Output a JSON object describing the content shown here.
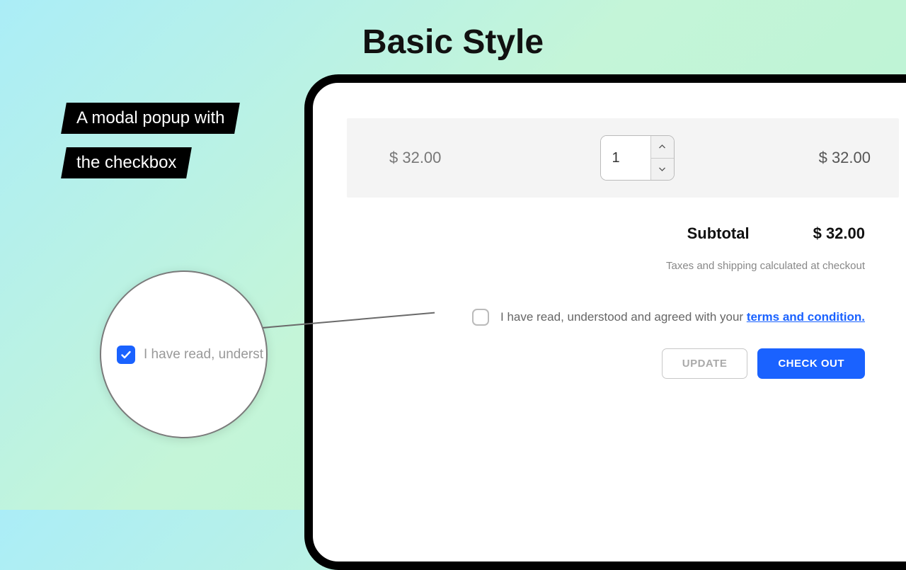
{
  "title": "Basic Style",
  "tag": {
    "line1": "A modal popup with",
    "line2": "the checkbox"
  },
  "cart": {
    "unit_price": "$ 32.00",
    "quantity": "1",
    "line_total": "$ 32.00",
    "subtotal_label": "Subtotal",
    "subtotal_value": "$ 32.00",
    "tax_note": "Taxes and shipping calculated at checkout"
  },
  "agree": {
    "text": "I have read, understood and agreed with your ",
    "link": "terms and condition."
  },
  "buttons": {
    "update": "UPDATE",
    "checkout": "CHECK OUT"
  },
  "zoom": {
    "text": "I have read, underst"
  }
}
